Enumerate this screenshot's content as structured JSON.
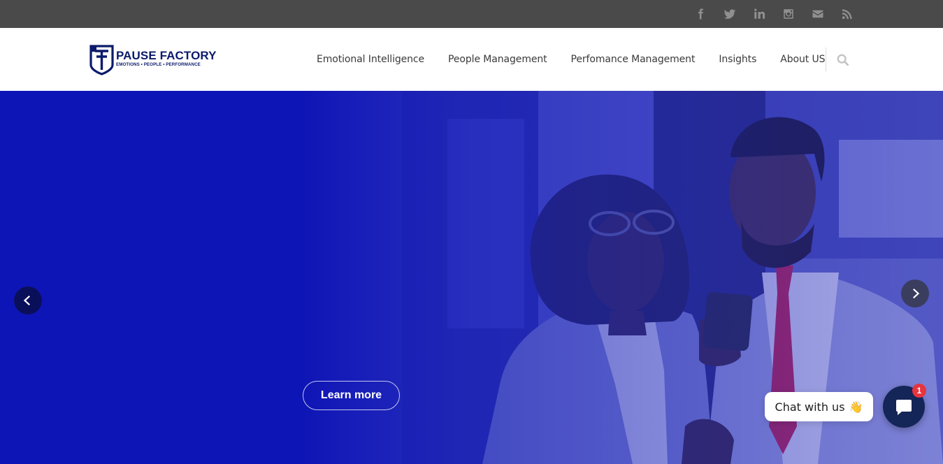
{
  "brand": {
    "name": "PAUSE FACTORY",
    "tagline": "EMOTIONS • PEOPLE • PERFORMANCE",
    "color": "#0b1a6b"
  },
  "social": [
    {
      "icon": "facebook-icon"
    },
    {
      "icon": "twitter-icon"
    },
    {
      "icon": "linkedin-icon"
    },
    {
      "icon": "instagram-icon"
    },
    {
      "icon": "mail-icon"
    },
    {
      "icon": "rss-icon"
    }
  ],
  "nav": {
    "items": [
      {
        "label": "Emotional Intelligence"
      },
      {
        "label": "People Management"
      },
      {
        "label": "Perfomance Management"
      },
      {
        "label": "Insights"
      },
      {
        "label": "About US"
      }
    ],
    "search_icon": "search-icon"
  },
  "hero": {
    "cta_label": "Learn more",
    "overlay_color": "#0c13b4"
  },
  "chat": {
    "label": "Chat with us",
    "emoji": "👋",
    "badge_count": "1",
    "launcher_color": "#142557",
    "badge_color": "#e8343d"
  }
}
